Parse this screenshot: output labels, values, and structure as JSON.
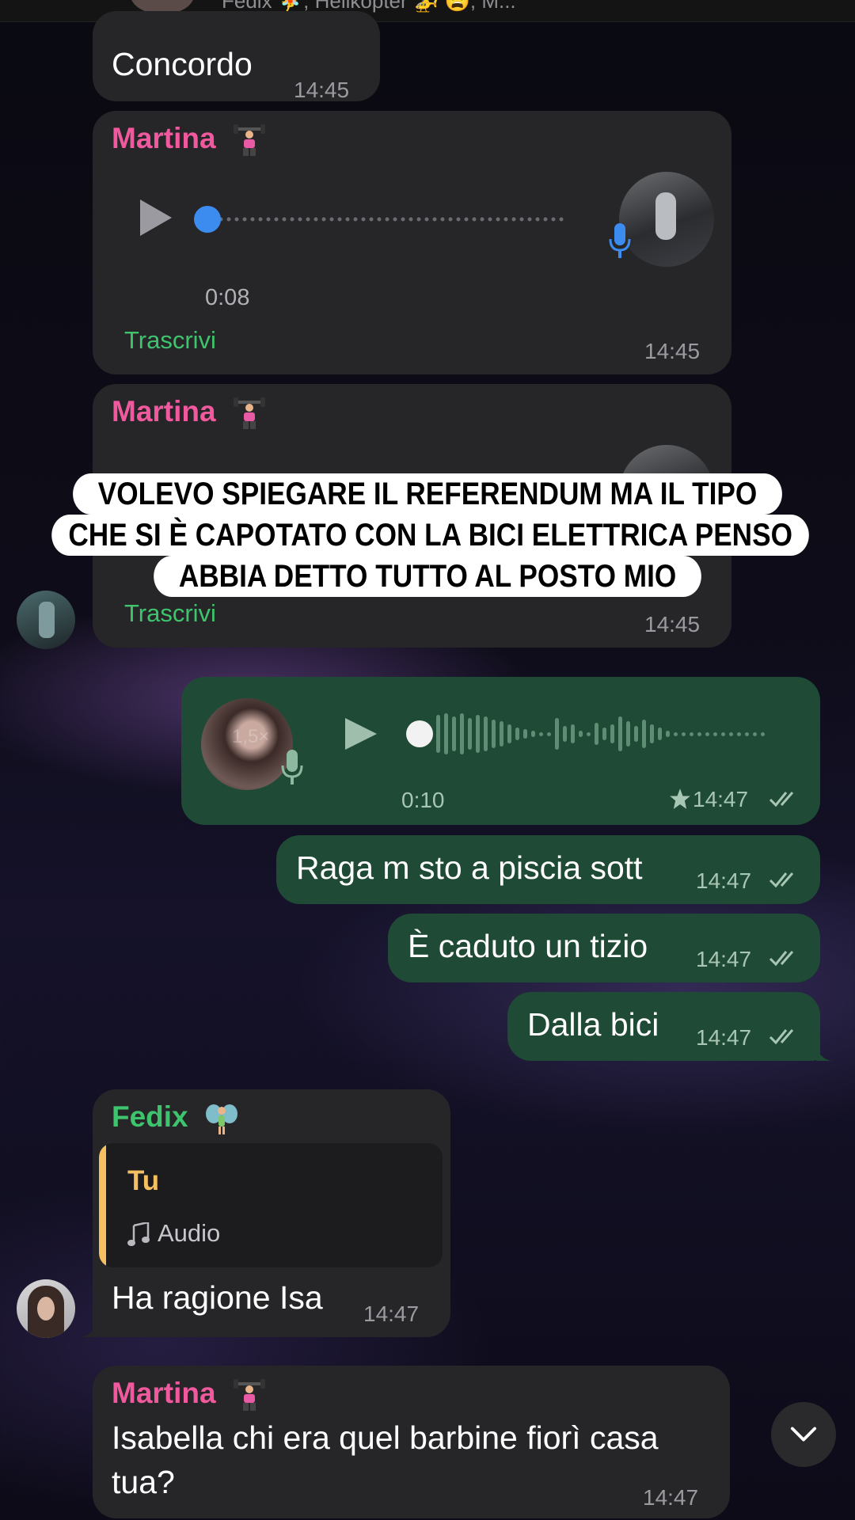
{
  "header": {
    "subtitle": "Fedix 🧚, Helikopter 🚁 😩, M..."
  },
  "messages": {
    "m1": {
      "text": "Concordo",
      "time": "14:45"
    },
    "m2": {
      "sender": "Martina",
      "duration": "0:08",
      "transcribe": "Trascrivi",
      "time": "14:45"
    },
    "m3": {
      "sender": "Martina",
      "transcribe": "Trascrivi",
      "time": "14:45"
    },
    "m4": {
      "duration": "0:10",
      "time": "14:47",
      "speed": "1,5×"
    },
    "m5": {
      "text": "Raga m sto a piscia sott",
      "time": "14:47"
    },
    "m6": {
      "text": "È caduto un tizio",
      "time": "14:47"
    },
    "m7": {
      "text": "Dalla bici",
      "time": "14:47"
    },
    "m8": {
      "sender": "Fedix",
      "reply_author": "Tu",
      "reply_type": "Audio",
      "text": "Ha ragione Isa",
      "time": "14:47"
    },
    "m9": {
      "sender": "Martina",
      "text_line1": "Isabella chi era quel barbine fiorì casa",
      "text_line2": "tua?",
      "time": "14:47"
    }
  },
  "caption": {
    "line1": "VOLEVO SPIEGARE IL REFERENDUM MA IL TIPO",
    "line2": "CHE SI È CAPOTATO CON LA BICI ELETTRICA PENSO",
    "line3": "ABBIA DETTO TUTTO AL POSTO MIO"
  },
  "colors": {
    "incoming_bubble": "#262628",
    "outgoing_bubble": "#1f4a35",
    "sender_martina": "#f0599e",
    "sender_fedix": "#3ec46d",
    "reply_bar": "#f5c060",
    "voice_progress": "#3c8cf0"
  },
  "icons": [
    "play-icon",
    "mic-icon",
    "star-icon",
    "double-check-icon",
    "music-note-icon",
    "chevron-down-icon"
  ]
}
